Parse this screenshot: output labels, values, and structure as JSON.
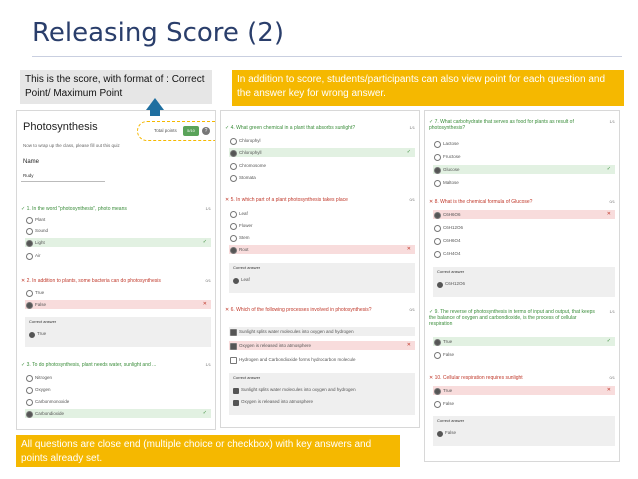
{
  "slide": {
    "title": "Releasing Score (2)",
    "note_score": "This is the score, with format of : Correct Point/ Maximum Point",
    "note_view": "In addition to score, students/participants can also view point for each question and the answer key for wrong answer.",
    "note_close": "All questions are close end (multiple choice or checkbox) with key answers and points already set."
  },
  "quiz": {
    "title": "Photosynthesis",
    "subtitle": "Now to wrap up the class, please fill out this quiz",
    "name_label": "Name",
    "name_value": "Rudy",
    "total_label": "Total points",
    "total_value": "5/10",
    "help": "?",
    "answer_key_label": "Correct answer",
    "q1": {
      "text": "1. In the word \"photosynthesis\", photo means",
      "points": "1/1",
      "options": [
        "Plant",
        "Sound",
        "Light",
        "Air"
      ]
    },
    "q2": {
      "text": "2. In addition to plants, some bacteria can do photosynthesis",
      "points": "0/1",
      "options": [
        "True",
        "False"
      ],
      "key": "True"
    },
    "q3": {
      "text": "3. To do photosynthesis, plant needs water, sunlight and ...",
      "points": "1/1",
      "options": [
        "Nitrogen",
        "Oxygen",
        "Carbonmonoxide",
        "Carbondioxide"
      ]
    },
    "q4": {
      "text": "4. What green chemical in a plant that absorbs sunlight?",
      "points": "1/1",
      "options": [
        "Chlorophyl",
        "Chlorophyll",
        "Chromosome",
        "Stomata"
      ]
    },
    "q5": {
      "text": "5. In which part of a plant photosynthesis takes place",
      "points": "0/1",
      "options": [
        "Leaf",
        "Flower",
        "Stem",
        "Root"
      ],
      "key": "Leaf"
    },
    "q6": {
      "text": "6. Which of the following processes involved in photosynthesis?",
      "points": "0/1",
      "options": [
        "Sunlight splits water molecules into oxygen and hydrogen",
        "Oxygen is released into atmosphere",
        "Hydrogen and Carbondioxide forms hydrocarbon molecule"
      ],
      "key": [
        "Sunlight splits water molecules into oxygen and hydrogen",
        "Oxygen is released into atmosphere"
      ]
    },
    "q7": {
      "text": "7. What carbohydrate that serves as food for plants as result of photosynthesis?",
      "points": "1/1",
      "options": [
        "Lactose",
        "Fructose",
        "Glucose",
        "Maltose"
      ]
    },
    "q8": {
      "text": "8. What is the chemical formula of Glucose?",
      "points": "0/1",
      "options": [
        "C6H6O6",
        "C6H12O6",
        "C6H6O4",
        "C4H4O4"
      ],
      "key": "C6H12O6"
    },
    "q9": {
      "text": "9. The reverse of photosynthesis in terms of input and output, that keeps the balance of oxygen and carbondioxide, is the process of cellular respiration",
      "points": "1/1",
      "options": [
        "True",
        "False"
      ]
    },
    "q10": {
      "text": "10. Cellular respiration requires sunlight",
      "points": "0/1",
      "options": [
        "True",
        "False"
      ],
      "key": "False"
    }
  },
  "colors": {
    "accent": "#f5b800",
    "correct": "#3a8d3a",
    "wrong": "#c0392b",
    "title": "#2a3e6b"
  },
  "icons": {
    "correct": "check-icon",
    "wrong": "cross-icon"
  }
}
